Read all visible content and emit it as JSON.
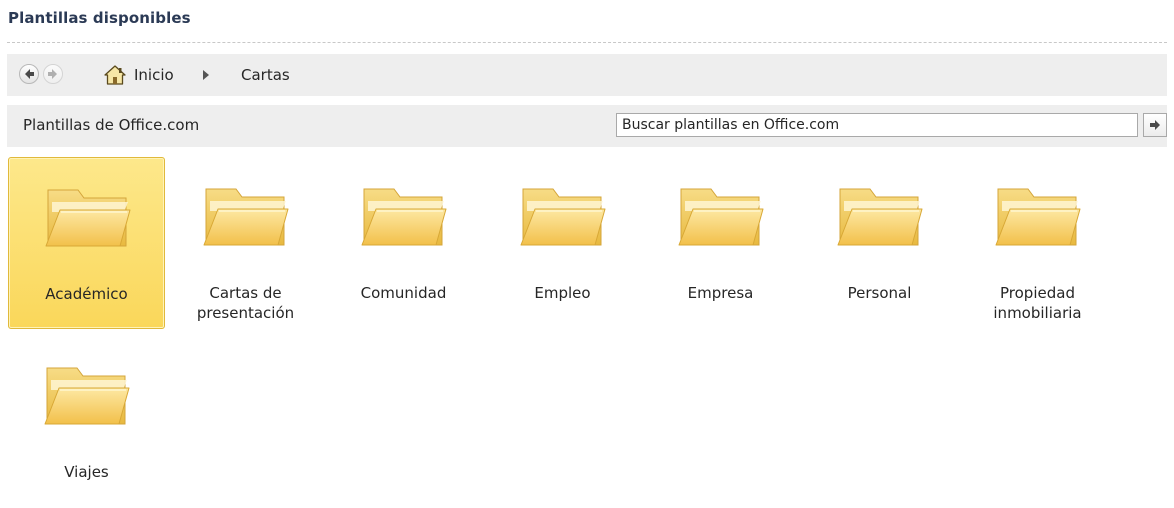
{
  "header": {
    "title": "Plantillas disponibles"
  },
  "breadcrumb": {
    "home_label": "Inicio",
    "current_label": "Cartas"
  },
  "office": {
    "label": "Plantillas de Office.com",
    "search_placeholder": "Buscar plantillas en Office.com"
  },
  "icons": {
    "back": "back-arrow-icon",
    "forward": "forward-arrow-icon",
    "home": "home-icon",
    "separator": "chevron-right-icon",
    "search_go": "arrow-right-icon",
    "folder": "folder-icon"
  },
  "colors": {
    "selected_tile": "#fad75a",
    "folder": "#f5c94b",
    "bar_background": "#eeeeee"
  },
  "folders": [
    {
      "label": "Académico",
      "selected": true
    },
    {
      "label": "Cartas de\npresentación",
      "selected": false
    },
    {
      "label": "Comunidad",
      "selected": false
    },
    {
      "label": "Empleo",
      "selected": false
    },
    {
      "label": "Empresa",
      "selected": false
    },
    {
      "label": "Personal",
      "selected": false
    },
    {
      "label": "Propiedad\ninmobiliaria",
      "selected": false
    },
    {
      "label": "Viajes",
      "selected": false
    }
  ]
}
